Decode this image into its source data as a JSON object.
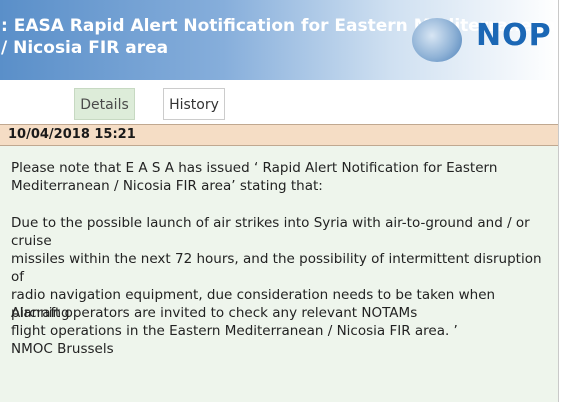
{
  "header": {
    "title": ": EASA Rapid Alert Notification for Eastern Mediterranean / Nicosia FIR\narea",
    "logo_text": "NOP"
  },
  "tabs": [
    {
      "label": "Details",
      "active": true
    },
    {
      "label": "History",
      "active": false
    }
  ],
  "notice": {
    "timestamp": "10/04/2018 15:21",
    "paragraphs": [
      "Please note that E A S A has issued ‘ Rapid Alert Notification for Eastern\nMediterranean / Nicosia FIR area’ stating that:",
      "Due to the possible launch of air strikes into Syria with air-to-ground and / or cruise\nmissiles within the next 72 hours, and the possibility of intermittent disruption of\nradio navigation equipment, due consideration needs to be taken when planning\nflight operations in the Eastern Mediterranean / Nicosia FIR area. ’",
      "Aircraft operators are invited to check any relevant NOTAMs",
      "NMOC Brussels"
    ]
  },
  "colors": {
    "header_start": "#5a8fc9",
    "active_tab": "#ddecd9",
    "date_bar": "#f5ddc5",
    "content_bg": "#eef5ec",
    "logo_blue": "#1b67b5"
  },
  "icons": {
    "logo": "eurocontrol-globe-icon"
  }
}
